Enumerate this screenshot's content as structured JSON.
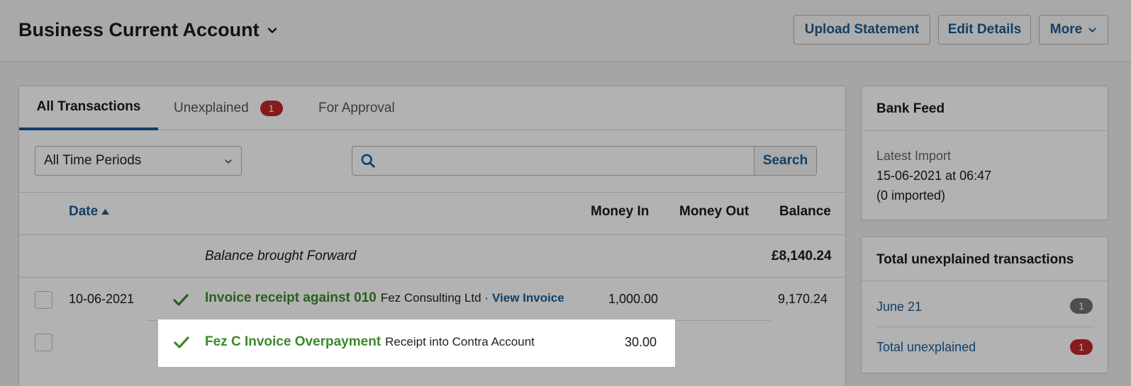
{
  "header": {
    "account_title": "Business Current Account",
    "buttons": {
      "upload_statement": "Upload Statement",
      "edit_details": "Edit Details",
      "more": "More"
    }
  },
  "tabs": {
    "all_transactions": "All Transactions",
    "unexplained": "Unexplained",
    "unexplained_count": "1",
    "for_approval": "For Approval"
  },
  "filters": {
    "period": "All Time Periods",
    "search_value": "",
    "search_button": "Search"
  },
  "table": {
    "headers": {
      "date": "Date",
      "money_in": "Money In",
      "money_out": "Money Out",
      "balance": "Balance"
    },
    "brought_forward": {
      "label": "Balance brought Forward",
      "balance": "£8,140.24"
    },
    "rows": [
      {
        "date": "10-06-2021",
        "title": "Invoice receipt against 010",
        "detail": "Fez Consulting Ltd ·",
        "link": "View Invoice",
        "money_in": "1,000.00",
        "money_out": "",
        "balance": "9,170.24"
      },
      {
        "date": "",
        "title": "Fez C Invoice Overpayment",
        "detail": "Receipt into Contra Account",
        "link": "",
        "money_in": "30.00",
        "money_out": "",
        "balance": ""
      }
    ]
  },
  "bank_feed": {
    "title": "Bank Feed",
    "label": "Latest Import",
    "date": "15-06-2021 at 06:47",
    "count": "(0 imported)"
  },
  "unexplained_panel": {
    "title": "Total unexplained transactions",
    "items": [
      {
        "label": "June 21",
        "count": "1"
      },
      {
        "label": "Total unexplained",
        "count": "1"
      }
    ]
  },
  "colors": {
    "brand_blue": "#1a5c96",
    "success_green": "#3a8a2a",
    "alert_red": "#c0282d"
  }
}
